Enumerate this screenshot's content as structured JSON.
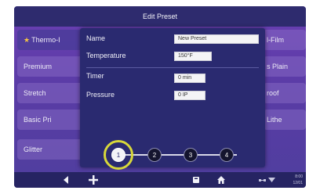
{
  "window": {
    "title": "Edit Preset"
  },
  "background_list": {
    "left_items": [
      "Thermo-I",
      "Premium",
      "Stretch",
      "Basic Pri",
      "Glitter"
    ],
    "right_items": [
      "l-Film",
      "s Plain",
      "roof",
      "Lithe"
    ]
  },
  "dialog": {
    "name_label": "Name",
    "name_value": "New Preset",
    "temperature_label": "Temperature",
    "temperature_value": "150°F",
    "timer_label": "Timer",
    "timer_value": "0 min",
    "pressure_label": "Pressure",
    "pressure_value": "0 IP",
    "steps": [
      "1",
      "2",
      "3",
      "4"
    ],
    "active_step": 1,
    "highlight_color": "#d8d83a"
  },
  "bottom_bar": {
    "icons": [
      "back-icon",
      "add-icon",
      "storage-icon",
      "home-icon",
      "network-icon",
      "wifi-icon"
    ],
    "status_time_line1": "8:00",
    "status_time_line2": "12/01"
  },
  "colors": {
    "title_bar": "#2e2b6e",
    "dialog_bg": "#2a2a70",
    "screen_top": "#6b3fb3"
  }
}
